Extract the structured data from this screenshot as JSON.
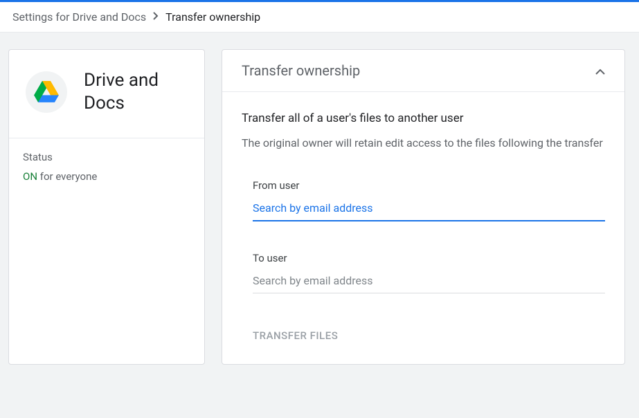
{
  "breadcrumb": {
    "parent": "Settings for Drive and Docs",
    "current": "Transfer ownership"
  },
  "sidebar": {
    "app_title": "Drive and Docs",
    "status_label": "Status",
    "status_on": "ON",
    "status_rest": " for everyone"
  },
  "main": {
    "section_title": "Transfer ownership",
    "desc_title": "Transfer all of a user's files to another user",
    "desc_sub": "The original owner will retain edit access to the files following the transfer",
    "from_label": "From user",
    "from_placeholder": "Search by email address",
    "from_value": "",
    "to_label": "To user",
    "to_placeholder": "Search by email address",
    "to_value": "",
    "transfer_button": "TRANSFER FILES"
  }
}
